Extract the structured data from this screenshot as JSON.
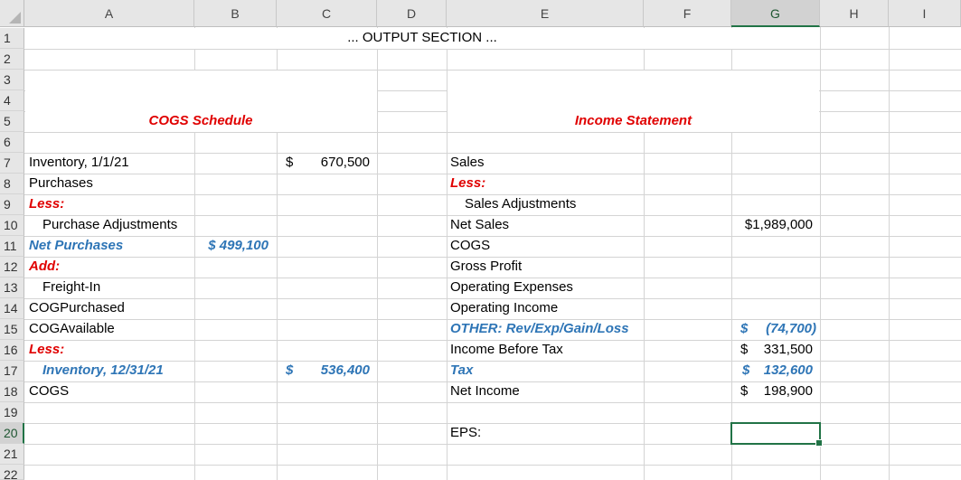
{
  "columns": [
    "A",
    "B",
    "C",
    "D",
    "E",
    "F",
    "G",
    "H",
    "I"
  ],
  "rows": [
    "1",
    "2",
    "3",
    "4",
    "5",
    "6",
    "7",
    "8",
    "9",
    "10",
    "11",
    "12",
    "13",
    "14",
    "15",
    "16",
    "17",
    "18",
    "19",
    "20",
    "21",
    "22"
  ],
  "selected_cell": "G20",
  "colors": {
    "red_label": "#e00000",
    "blue_label": "#2e75b6",
    "selection": "#217346"
  },
  "output_title": "... OUTPUT SECTION ...",
  "cogs": {
    "title": "COGS Schedule",
    "inventory_start": "Inventory, 1/1/21",
    "inventory_start_dollar": "$",
    "inventory_start_value": "670,500",
    "purchases": "Purchases",
    "less_1": "Less:",
    "purchase_adjustments": "Purchase Adjustments",
    "net_purchases": "Net Purchases",
    "net_purchases_value": "$ 499,100",
    "add": "Add:",
    "freight_in": "Freight-In",
    "cog_purchased": "COGPurchased",
    "cog_available": "COGAvailable",
    "less_2": "Less:",
    "inventory_end": "Inventory, 12/31/21",
    "inventory_end_dollar": "$",
    "inventory_end_value": "536,400",
    "cogs_label": "COGS"
  },
  "income": {
    "title": "Income Statement",
    "sales": "Sales",
    "less": "Less:",
    "sales_adjustments": "Sales Adjustments",
    "net_sales": "Net Sales",
    "net_sales_value": "$1,989,000",
    "cogs": "COGS",
    "gross_profit": "Gross Profit",
    "operating_expenses": "Operating Expenses",
    "operating_income": "Operating Income",
    "other": "OTHER: Rev/Exp/Gain/Loss",
    "other_dollar": "$",
    "other_value": "(74,700)",
    "income_before_tax": "Income Before Tax",
    "ibt_dollar": "$",
    "ibt_value": "331,500",
    "tax": "Tax",
    "tax_dollar": "$",
    "tax_value": "132,600",
    "net_income": "Net Income",
    "ni_dollar": "$",
    "ni_value": "198,900",
    "eps": "EPS:"
  }
}
